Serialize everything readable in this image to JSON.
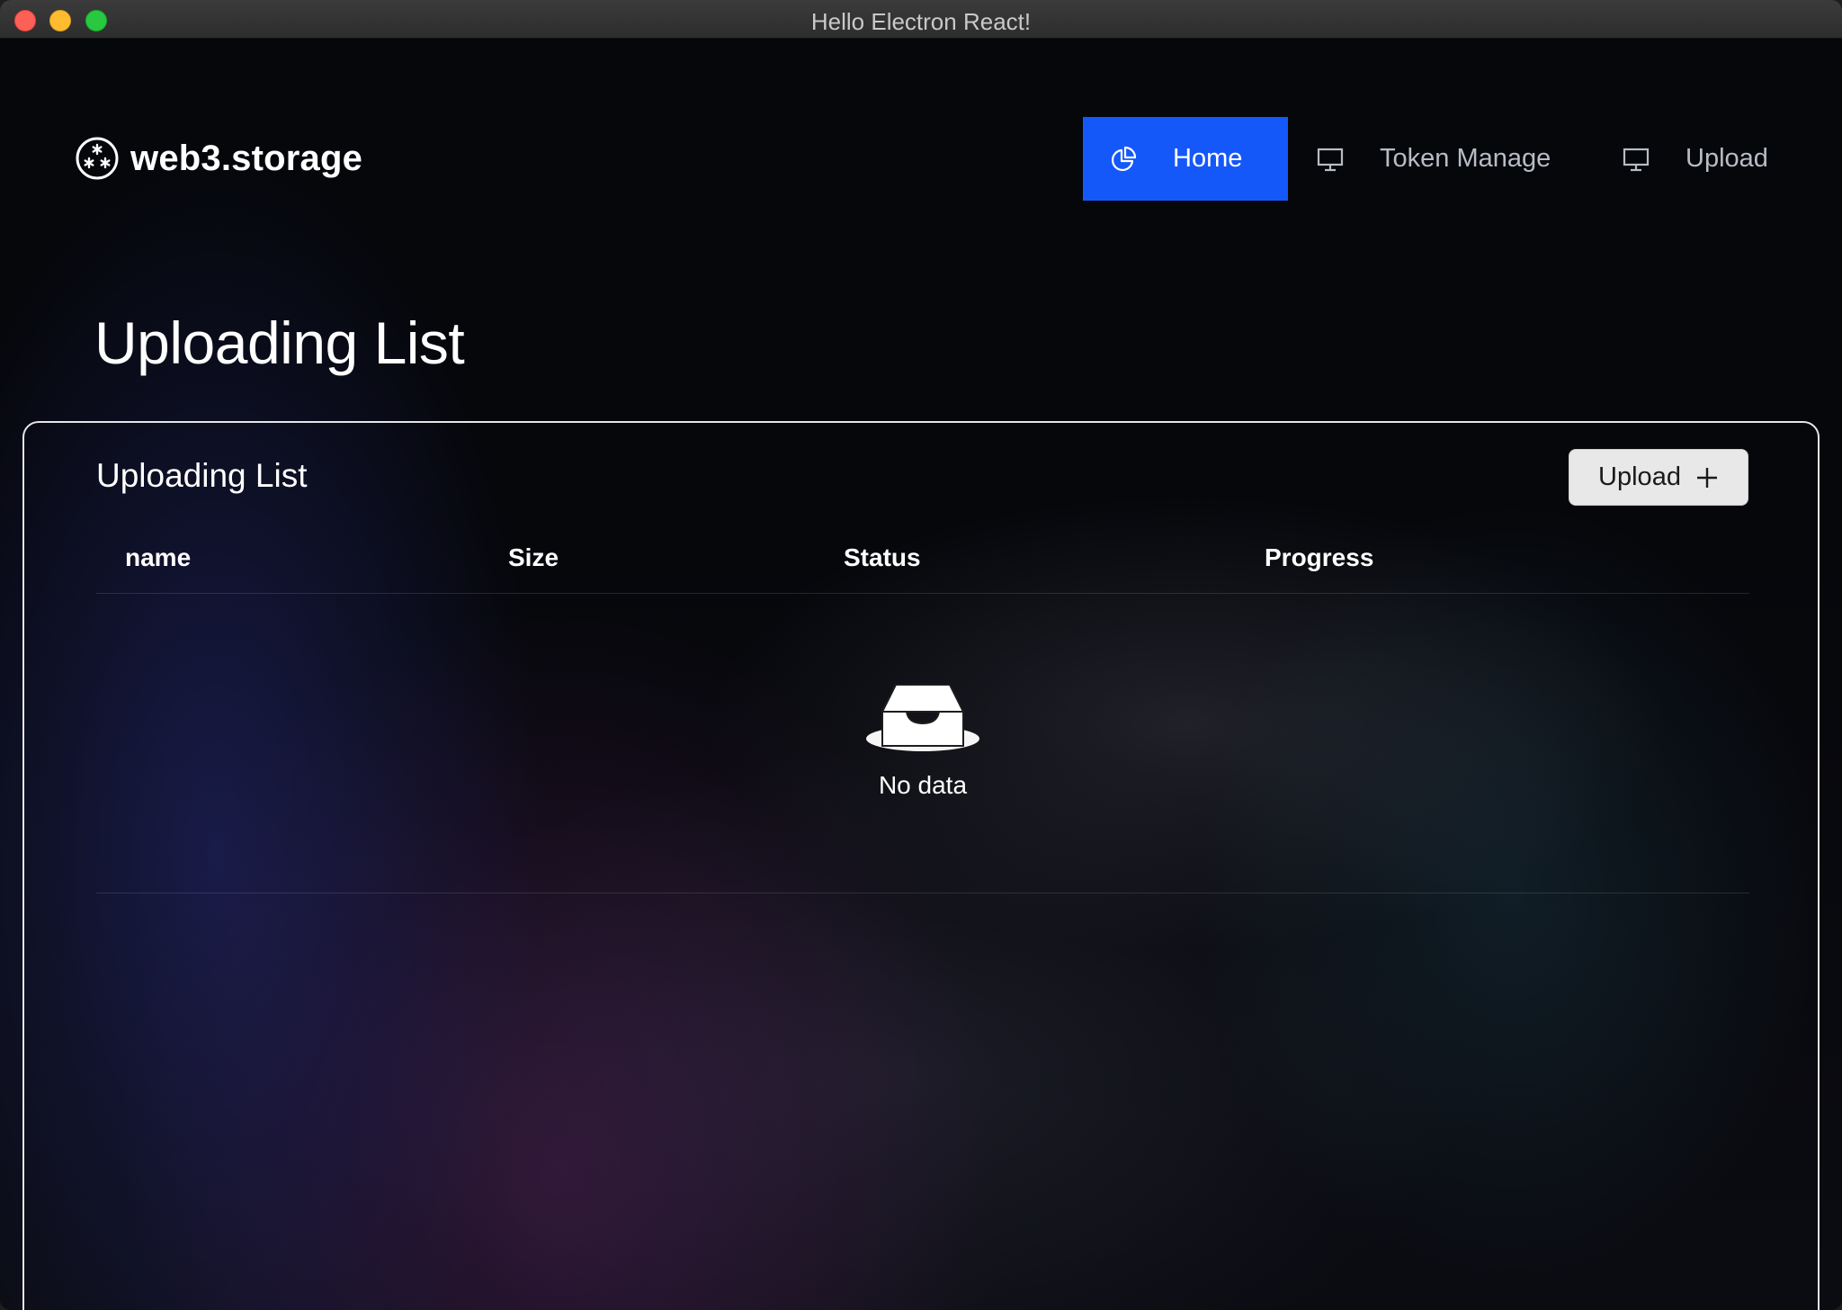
{
  "window": {
    "title": "Hello Electron React!"
  },
  "header": {
    "logo_text": "web3.storage",
    "logo_icon": "asterisks-circle-icon",
    "nav": [
      {
        "label": "Home",
        "icon": "pie-chart-icon",
        "active": true
      },
      {
        "label": "Token Manage",
        "icon": "desktop-icon",
        "active": false
      },
      {
        "label": "Upload",
        "icon": "desktop-icon",
        "active": false
      }
    ]
  },
  "main": {
    "page_title": "Uploading List",
    "card": {
      "title": "Uploading List",
      "upload_button_label": "Upload",
      "upload_button_icon": "plus-icon",
      "table": {
        "columns": [
          "name",
          "Size",
          "Status",
          "Progress"
        ],
        "rows": [],
        "empty_text": "No data",
        "empty_icon": "empty-inbox-icon"
      }
    }
  },
  "colors": {
    "accent": "#1558fa",
    "background": "#05070a",
    "text": "#ffffff"
  }
}
